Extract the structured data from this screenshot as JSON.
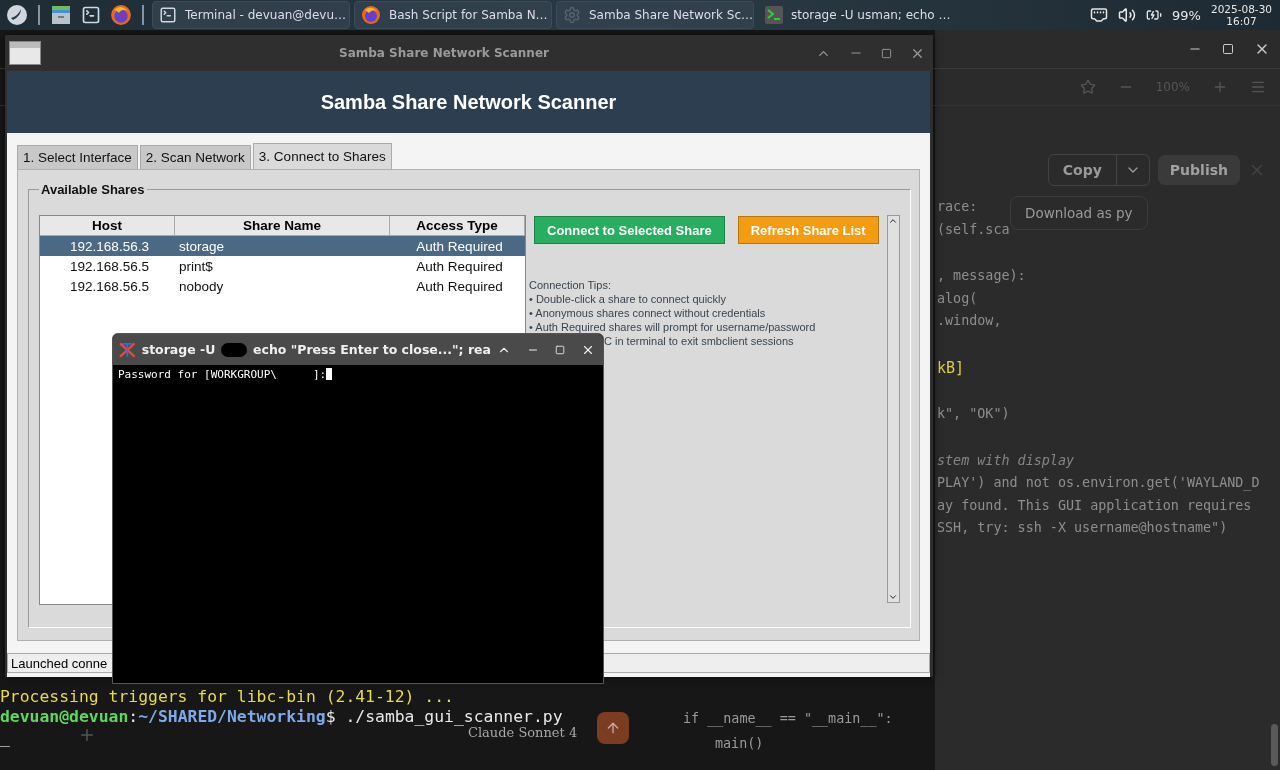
{
  "taskbar": {
    "tasks": [
      {
        "kind": "terminal",
        "title": "Terminal - devuan@devu…"
      },
      {
        "kind": "browser",
        "title": "Bash Script for Samba N…"
      },
      {
        "kind": "settings",
        "title": "Samba Share Network Sc…"
      },
      {
        "kind": "console",
        "title": "storage -U usman; echo …"
      }
    ],
    "battery": "99%",
    "date": "2025-08-30",
    "time": "16:07"
  },
  "browser": {
    "zoom": "100%",
    "copy": "Copy",
    "publish": "Publish",
    "menu_item": "Download as py",
    "code_blocks": [
      [
        {
          "kind": "plain",
          "text": "race:"
        },
        {
          "kind": "plain",
          "text": "(self.sca"
        }
      ],
      [
        {
          "kind": "plain",
          "text": ", message):"
        },
        {
          "kind": "plain",
          "text": "alog("
        },
        {
          "kind": "plain",
          "text": ".window,"
        }
      ],
      [
        {
          "kind": "string",
          "text": "kB]"
        }
      ],
      [
        {
          "kind": "plain",
          "text": "k\", \"OK\")"
        }
      ],
      [
        {
          "kind": "comment",
          "text": "stem with display"
        },
        {
          "kind": "plain",
          "text": "PLAY') and not os.environ.get('WAYLAND_D"
        },
        {
          "kind": "plain",
          "text": "ay found. This GUI application requires"
        },
        {
          "kind": "plain",
          "text": "SSH, try: ssh -X username@hostname\")"
        }
      ]
    ],
    "main_lines": [
      {
        "text": "if __name__ == \"__main__\":",
        "children": [
          {
            "text": "main()"
          }
        ]
      }
    ],
    "model": "Claude Sonnet 4"
  },
  "terminal": {
    "lines": [
      "Processing triggers for libc-bin (2.41-12) ..."
    ],
    "prompt": [
      {
        "kind": "user",
        "text": "devuan@devuan"
      },
      {
        "kind": "plain",
        "text": ":"
      },
      {
        "kind": "path",
        "text": "~/SHARED/Networking"
      },
      {
        "kind": "plain",
        "text": "$ ./samba_gui_scanner.py"
      }
    ],
    "cursor": "_"
  },
  "scanner": {
    "window_title": "Samba Share Network Scanner",
    "header": "Samba Share Network Scanner",
    "tabs": [
      {
        "label": "1. Select Interface",
        "selected": false
      },
      {
        "label": "2. Scan Network",
        "selected": false
      },
      {
        "label": "3. Connect to Shares",
        "selected": true
      }
    ],
    "group_title": "Available Shares",
    "columns": [
      "Host",
      "Share Name",
      "Access Type"
    ],
    "rows": [
      {
        "host": "192.168.56.3",
        "share": "storage",
        "access": "Auth Required",
        "selected": true
      },
      {
        "host": "192.168.56.5",
        "share": "print$",
        "access": "Auth Required",
        "selected": false
      },
      {
        "host": "192.168.56.5",
        "share": "nobody",
        "access": "Auth Required",
        "selected": false
      }
    ],
    "buttons": [
      {
        "kind": "primary",
        "label": "Connect to Selected Share"
      },
      {
        "kind": "warning",
        "label": "Refresh Share List"
      }
    ],
    "tips_title": "Connection Tips:",
    "tips": [
      "• Double-click a share to connect quickly",
      "• Anonymous shares connect without credentials",
      "• Auth Required shares will prompt for username/password"
    ],
    "tip_fragment": "C in terminal to exit smbclient sessions",
    "status": "Launched conne"
  },
  "xterm": {
    "title_start": "storage -U",
    "title_end": "echo \"Press Enter to close...\"; rea",
    "prompt": "Password for [WORKGROUP\\",
    "prompt_end": "]:"
  }
}
